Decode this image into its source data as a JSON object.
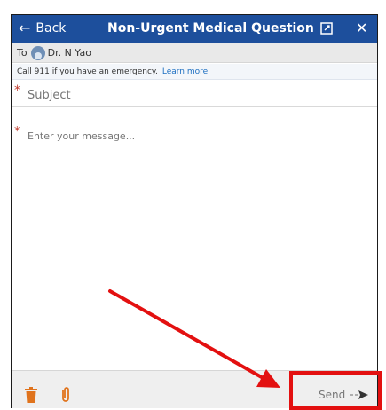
{
  "header": {
    "back_label": "Back",
    "title": "Non-Urgent Medical Question",
    "popout_icon": "popout-icon",
    "close_label": "✕"
  },
  "recipient": {
    "to_label": "To",
    "name": "Dr. N Yao"
  },
  "notice": {
    "text": "Call 911 if you have an emergency.",
    "link": "Learn more"
  },
  "form": {
    "subject_placeholder": "Subject",
    "message_placeholder": "Enter your message...",
    "required_marker": "*"
  },
  "footer": {
    "send_label": "Send"
  },
  "colors": {
    "header_bg": "#1d4f9c",
    "trash": "#e0731c",
    "clip": "#e0731c",
    "annotation": "#e31010"
  }
}
